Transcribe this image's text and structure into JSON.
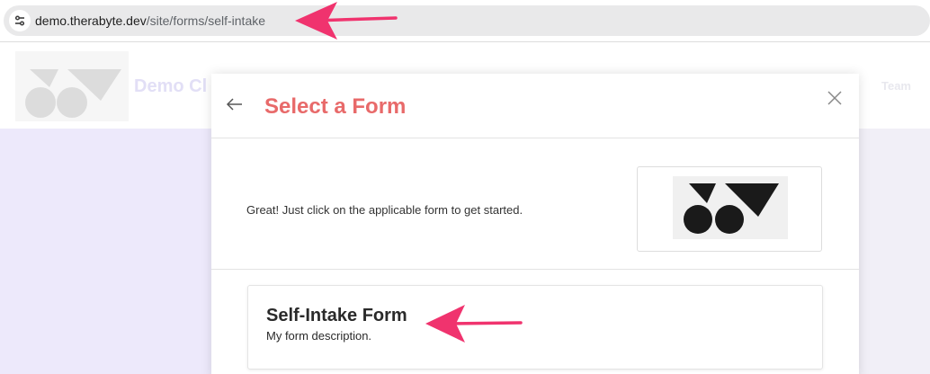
{
  "browser": {
    "url_host": "demo.therabyte.dev",
    "url_path": "/site/forms/self-intake",
    "site_info_icon": "tune-icon"
  },
  "site": {
    "title": "Demo Cl",
    "nav_team": "Team",
    "logo_icon": "brand-logo-icon"
  },
  "modal": {
    "title": "Select a Form",
    "back_icon": "arrow-left-icon",
    "close_icon": "close-icon",
    "intro_text": "Great! Just click on the applicable form to get started.",
    "logo_icon": "brand-logo-icon",
    "forms": [
      {
        "name": "Self-Intake Form",
        "description": "My form description."
      }
    ]
  },
  "annotations": {
    "color": "#f0336e",
    "arrows": [
      "url-pointer-arrow",
      "form-pointer-arrow"
    ]
  },
  "colors": {
    "title_accent": "#e86a6a",
    "site_background": "#ede9fb"
  }
}
